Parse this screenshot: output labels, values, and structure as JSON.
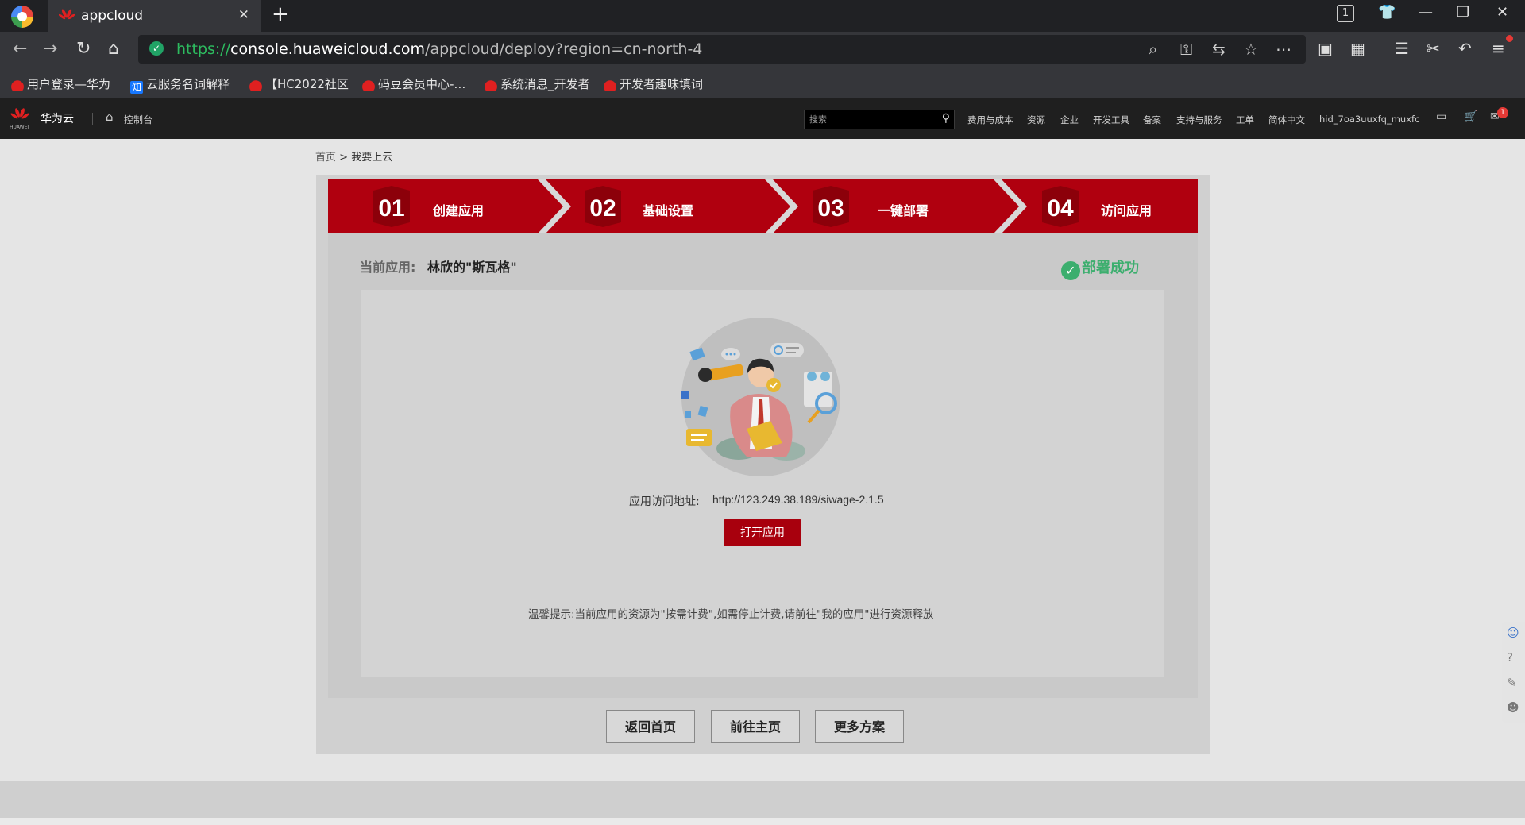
{
  "browser": {
    "tab_title": "appcloud",
    "tab_count": "1",
    "url_scheme": "https://",
    "url_host": "console.huaweicloud.com",
    "url_path": "/appcloud/deploy?region=cn-north-4",
    "bookmarks": [
      "用户登录—华为",
      "云服务名词解释",
      "【HC2022社区",
      "码豆会员中心-…",
      "系统消息_开发者",
      "开发者趣味填词"
    ]
  },
  "header": {
    "logo_text": "HUAWEI",
    "brand": "华为云",
    "console": "控制台",
    "search_placeholder": "搜索",
    "nav": [
      "费用与成本",
      "资源",
      "企业",
      "开发工具",
      "备案",
      "支持与服务",
      "工单",
      "简体中文",
      "hid_7oa3uuxfq_muxfc"
    ],
    "message_count": "1"
  },
  "breadcrumb": {
    "home": "首页",
    "separator": ">",
    "current": "我要上云"
  },
  "steps": [
    {
      "num": "01",
      "label": "创建应用"
    },
    {
      "num": "02",
      "label": "基础设置"
    },
    {
      "num": "03",
      "label": "一键部署"
    },
    {
      "num": "04",
      "label": "访问应用"
    }
  ],
  "app": {
    "current_label": "当前应用:",
    "current_name": "林欣的\"斯瓦格\"",
    "status": "部署成功",
    "address_label": "应用访问地址:",
    "address": "http://123.249.38.189/siwage-2.1.5",
    "open_button": "打开应用",
    "tip": "温馨提示:当前应用的资源为\"按需计费\",如需停止计费,请前往\"我的应用\"进行资源释放"
  },
  "buttons": {
    "back_home": "返回首页",
    "go_main": "前往主页",
    "more_plans": "更多方案"
  },
  "colors": {
    "brand_red": "#a8000d",
    "success_green": "#3cae6e"
  }
}
